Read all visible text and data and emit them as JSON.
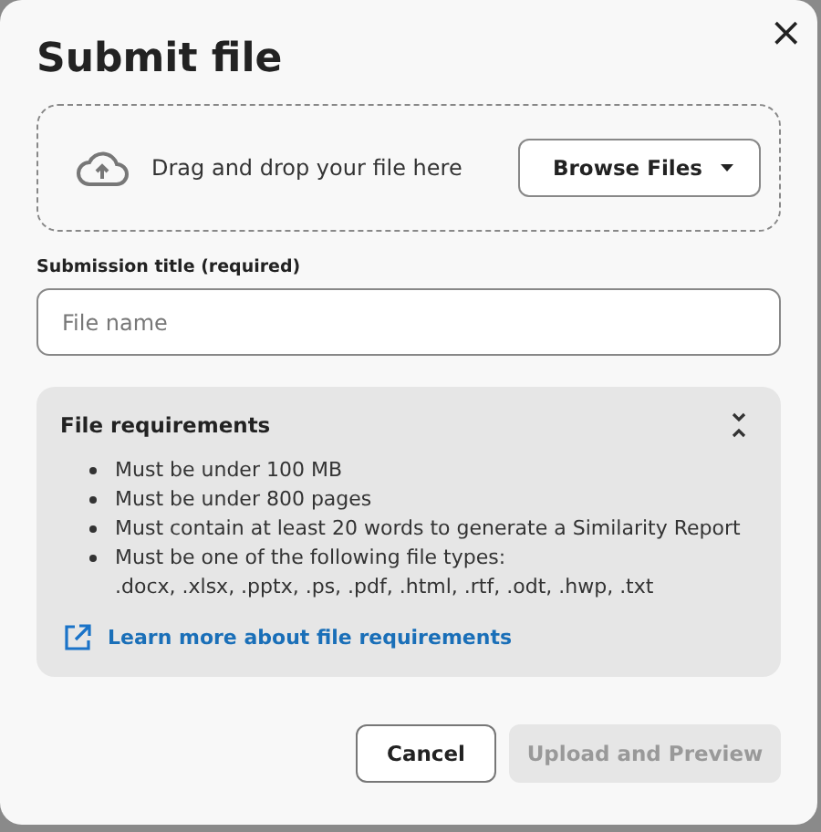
{
  "dialog": {
    "title": "Submit file",
    "close": "×"
  },
  "dropzone": {
    "text": "Drag and drop your file here",
    "browse_button": "Browse Files"
  },
  "title_field": {
    "label": "Submission title (required)",
    "placeholder": "File name"
  },
  "requirements": {
    "title": "File requirements",
    "expanded": true,
    "items": [
      {
        "text": "Must be under 100 MB"
      },
      {
        "text": "Must be under 800 pages"
      },
      {
        "text": "Must contain at least 20 words to generate a Similarity Report"
      },
      {
        "text": "Must be one of the following file types:",
        "detail": ".docx, .xlsx, .pptx, .ps, .pdf, .html, .rtf, .odt, .hwp, .txt"
      }
    ],
    "link": "Learn more about file requirements"
  },
  "buttons": [
    {
      "label": "Cancel",
      "kind": "secondary",
      "disabled": false
    },
    {
      "label": "Upload and Preview",
      "kind": "primary",
      "disabled": true
    }
  ]
}
